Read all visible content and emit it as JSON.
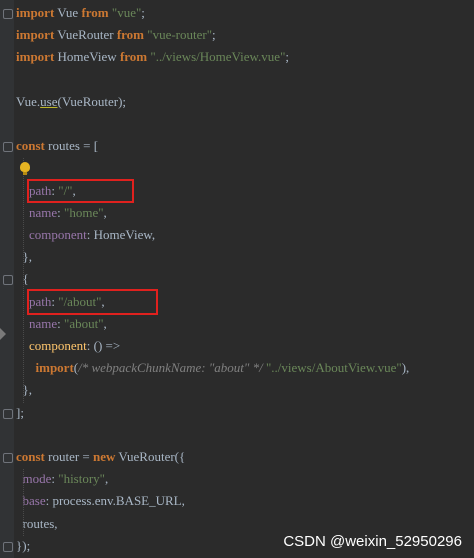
{
  "code": {
    "lines": [
      {
        "t": [
          [
            "kw",
            "import"
          ],
          [
            "plain",
            " Vue "
          ],
          [
            "kw",
            "from"
          ],
          [
            "plain",
            " "
          ],
          [
            "str",
            "\"vue\""
          ],
          [
            "plain",
            ";"
          ]
        ]
      },
      {
        "t": [
          [
            "kw",
            "import"
          ],
          [
            "plain",
            " VueRouter "
          ],
          [
            "kw",
            "from"
          ],
          [
            "plain",
            " "
          ],
          [
            "str",
            "\"vue-router\""
          ],
          [
            "plain",
            ";"
          ]
        ]
      },
      {
        "t": [
          [
            "kw",
            "import"
          ],
          [
            "plain",
            " HomeView "
          ],
          [
            "kw",
            "from"
          ],
          [
            "plain",
            " "
          ],
          [
            "str",
            "\"../views/HomeView.vue\""
          ],
          [
            "plain",
            ";"
          ]
        ]
      },
      {
        "t": []
      },
      {
        "t": [
          [
            "plain",
            "Vue."
          ],
          [
            "sq",
            "use"
          ],
          [
            "plain",
            "(VueRouter);"
          ]
        ]
      },
      {
        "t": []
      },
      {
        "t": [
          [
            "kw",
            "const"
          ],
          [
            "plain",
            " routes = ["
          ]
        ]
      },
      {
        "t": [
          [
            "plain",
            "  {"
          ]
        ]
      },
      {
        "t": [
          [
            "plain",
            "    "
          ],
          [
            "prop",
            "path"
          ],
          [
            "plain",
            ": "
          ],
          [
            "str",
            "\"/\""
          ],
          [
            "plain",
            ","
          ]
        ]
      },
      {
        "t": [
          [
            "plain",
            "    "
          ],
          [
            "prop",
            "name"
          ],
          [
            "plain",
            ": "
          ],
          [
            "str",
            "\"home\""
          ],
          [
            "plain",
            ","
          ]
        ]
      },
      {
        "t": [
          [
            "plain",
            "    "
          ],
          [
            "prop",
            "component"
          ],
          [
            "plain",
            ": HomeView,"
          ]
        ]
      },
      {
        "t": [
          [
            "plain",
            "  },"
          ]
        ]
      },
      {
        "t": [
          [
            "plain",
            "  {"
          ]
        ]
      },
      {
        "t": [
          [
            "plain",
            "    "
          ],
          [
            "prop",
            "path"
          ],
          [
            "plain",
            ": "
          ],
          [
            "str",
            "\"/about\""
          ],
          [
            "plain",
            ","
          ]
        ]
      },
      {
        "t": [
          [
            "plain",
            "    "
          ],
          [
            "prop",
            "name"
          ],
          [
            "plain",
            ": "
          ],
          [
            "str",
            "\"about\""
          ],
          [
            "plain",
            ","
          ]
        ]
      },
      {
        "t": [
          [
            "plain",
            "    "
          ],
          [
            "fn",
            "component"
          ],
          [
            "plain",
            ": () =>"
          ]
        ]
      },
      {
        "t": [
          [
            "plain",
            "      "
          ],
          [
            "kw",
            "import"
          ],
          [
            "plain",
            "("
          ],
          [
            "cmt",
            "/* webpackChunkName: \"about\" */ "
          ],
          [
            "str",
            "\"../views/AboutView.vue\""
          ],
          [
            "plain",
            "),"
          ]
        ]
      },
      {
        "t": [
          [
            "plain",
            "  },"
          ]
        ]
      },
      {
        "t": [
          [
            "plain",
            "];"
          ]
        ]
      },
      {
        "t": []
      },
      {
        "t": [
          [
            "kw",
            "const"
          ],
          [
            "plain",
            " router = "
          ],
          [
            "kw",
            "new"
          ],
          [
            "plain",
            " VueRouter({"
          ]
        ]
      },
      {
        "t": [
          [
            "plain",
            "  "
          ],
          [
            "prop",
            "mode"
          ],
          [
            "plain",
            ": "
          ],
          [
            "str",
            "\"history\""
          ],
          [
            "plain",
            ","
          ]
        ]
      },
      {
        "t": [
          [
            "plain",
            "  "
          ],
          [
            "prop",
            "base"
          ],
          [
            "plain",
            ": process.env.BASE_URL,"
          ]
        ]
      },
      {
        "t": [
          [
            "plain",
            "  routes,"
          ]
        ]
      },
      {
        "t": [
          [
            "plain",
            "});"
          ]
        ]
      }
    ]
  },
  "highlights": [
    "path-root",
    "path-about"
  ],
  "icons": {
    "bulb": "lightbulb-icon",
    "arrow": "breakpoint-arrow-icon"
  },
  "colors": {
    "highlight": "#e0211e",
    "keyword": "#cc7832",
    "string": "#6a8759",
    "property": "#9876aa",
    "background": "#2b2b2b"
  },
  "watermark": "CSDN @weixin_52950296"
}
